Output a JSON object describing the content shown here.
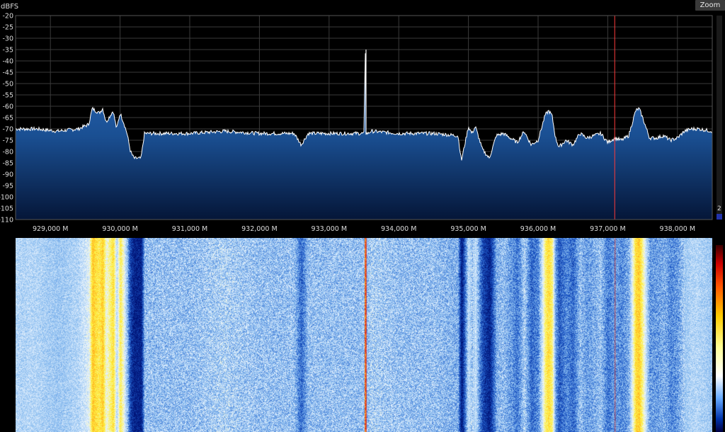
{
  "unit_label": "dBFS",
  "zoom_label": "Zoom",
  "slider_value": "2",
  "y_ticks": [
    "-20",
    "-25",
    "-30",
    "-35",
    "-40",
    "-45",
    "-50",
    "-55",
    "-60",
    "-65",
    "-70",
    "-75",
    "-80",
    "-85",
    "-90",
    "-95",
    "-100",
    "-105",
    "-110"
  ],
  "x_ticks": [
    "929,000 M",
    "930,000 M",
    "931,000 M",
    "932,000 M",
    "933,000 M",
    "934,000 M",
    "935,000 M",
    "936,000 M",
    "937,000 M",
    "938,000 M"
  ],
  "colors": {
    "panel_top": "#1e5aa8",
    "panel_bottom": "#061a3a",
    "trace": "#ffffff",
    "marker": "#ff3b3b",
    "grid": "#3a3a3a"
  },
  "chart_data": {
    "type": "area",
    "ylabel": "dBFS",
    "ylim": [
      -110,
      -20
    ],
    "xlim_mhz": [
      928.5,
      938.5
    ],
    "x_mhz": [
      928.5,
      928.8,
      929.1,
      929.4,
      929.55,
      929.6,
      929.7,
      929.75,
      929.8,
      929.9,
      929.95,
      930.0,
      930.05,
      930.1,
      930.15,
      930.2,
      930.3,
      930.35,
      930.5,
      931.0,
      931.5,
      932.0,
      932.5,
      932.6,
      932.7,
      933.0,
      933.5,
      933.52,
      933.53,
      933.56,
      933.6,
      934.0,
      934.5,
      934.85,
      934.9,
      935.0,
      935.05,
      935.1,
      935.2,
      935.3,
      935.4,
      935.5,
      935.6,
      935.7,
      935.8,
      935.9,
      936.0,
      936.1,
      936.15,
      936.2,
      936.25,
      936.3,
      936.4,
      936.5,
      936.6,
      936.7,
      936.8,
      936.9,
      937.0,
      937.1,
      937.2,
      937.3,
      937.4,
      937.45,
      937.5,
      937.6,
      937.7,
      937.8,
      937.9,
      938.0,
      938.1,
      938.2,
      938.3,
      938.5
    ],
    "y_dbfs": [
      -70,
      -70,
      -71,
      -70,
      -68,
      -61,
      -63,
      -61,
      -67,
      -62,
      -70,
      -63,
      -67,
      -72,
      -80,
      -83,
      -83,
      -72,
      -72,
      -72,
      -71,
      -72,
      -72,
      -77,
      -72,
      -72,
      -72,
      -35,
      -72,
      -72,
      -71,
      -72,
      -72,
      -73,
      -84,
      -69,
      -72,
      -69,
      -79,
      -83,
      -73,
      -72,
      -74,
      -76,
      -71,
      -77,
      -75,
      -64,
      -62,
      -64,
      -74,
      -78,
      -75,
      -77,
      -72,
      -74,
      -73,
      -72,
      -76,
      -74,
      -75,
      -73,
      -62,
      -61,
      -65,
      -74,
      -74,
      -73,
      -75,
      -74,
      -71,
      -70,
      -70,
      -71
    ],
    "marker_mhz": 937.1,
    "peak_signal_mhz": 933.53
  }
}
